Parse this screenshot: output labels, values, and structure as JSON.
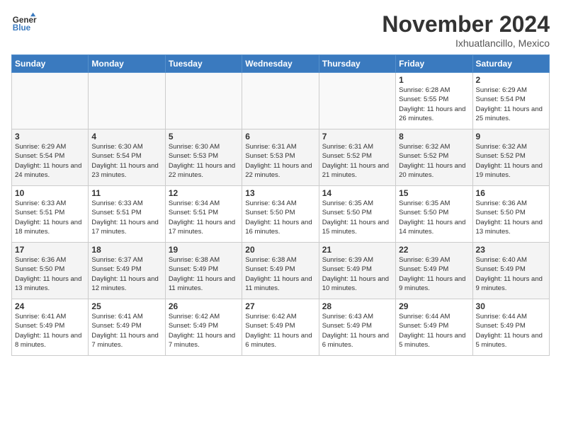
{
  "header": {
    "logo_line1": "General",
    "logo_line2": "Blue",
    "month": "November 2024",
    "location": "Ixhuatlancillo, Mexico"
  },
  "weekdays": [
    "Sunday",
    "Monday",
    "Tuesday",
    "Wednesday",
    "Thursday",
    "Friday",
    "Saturday"
  ],
  "weeks": [
    [
      {
        "day": "",
        "info": ""
      },
      {
        "day": "",
        "info": ""
      },
      {
        "day": "",
        "info": ""
      },
      {
        "day": "",
        "info": ""
      },
      {
        "day": "",
        "info": ""
      },
      {
        "day": "1",
        "info": "Sunrise: 6:28 AM\nSunset: 5:55 PM\nDaylight: 11 hours and 26 minutes."
      },
      {
        "day": "2",
        "info": "Sunrise: 6:29 AM\nSunset: 5:54 PM\nDaylight: 11 hours and 25 minutes."
      }
    ],
    [
      {
        "day": "3",
        "info": "Sunrise: 6:29 AM\nSunset: 5:54 PM\nDaylight: 11 hours and 24 minutes."
      },
      {
        "day": "4",
        "info": "Sunrise: 6:30 AM\nSunset: 5:54 PM\nDaylight: 11 hours and 23 minutes."
      },
      {
        "day": "5",
        "info": "Sunrise: 6:30 AM\nSunset: 5:53 PM\nDaylight: 11 hours and 22 minutes."
      },
      {
        "day": "6",
        "info": "Sunrise: 6:31 AM\nSunset: 5:53 PM\nDaylight: 11 hours and 22 minutes."
      },
      {
        "day": "7",
        "info": "Sunrise: 6:31 AM\nSunset: 5:52 PM\nDaylight: 11 hours and 21 minutes."
      },
      {
        "day": "8",
        "info": "Sunrise: 6:32 AM\nSunset: 5:52 PM\nDaylight: 11 hours and 20 minutes."
      },
      {
        "day": "9",
        "info": "Sunrise: 6:32 AM\nSunset: 5:52 PM\nDaylight: 11 hours and 19 minutes."
      }
    ],
    [
      {
        "day": "10",
        "info": "Sunrise: 6:33 AM\nSunset: 5:51 PM\nDaylight: 11 hours and 18 minutes."
      },
      {
        "day": "11",
        "info": "Sunrise: 6:33 AM\nSunset: 5:51 PM\nDaylight: 11 hours and 17 minutes."
      },
      {
        "day": "12",
        "info": "Sunrise: 6:34 AM\nSunset: 5:51 PM\nDaylight: 11 hours and 17 minutes."
      },
      {
        "day": "13",
        "info": "Sunrise: 6:34 AM\nSunset: 5:50 PM\nDaylight: 11 hours and 16 minutes."
      },
      {
        "day": "14",
        "info": "Sunrise: 6:35 AM\nSunset: 5:50 PM\nDaylight: 11 hours and 15 minutes."
      },
      {
        "day": "15",
        "info": "Sunrise: 6:35 AM\nSunset: 5:50 PM\nDaylight: 11 hours and 14 minutes."
      },
      {
        "day": "16",
        "info": "Sunrise: 6:36 AM\nSunset: 5:50 PM\nDaylight: 11 hours and 13 minutes."
      }
    ],
    [
      {
        "day": "17",
        "info": "Sunrise: 6:36 AM\nSunset: 5:50 PM\nDaylight: 11 hours and 13 minutes."
      },
      {
        "day": "18",
        "info": "Sunrise: 6:37 AM\nSunset: 5:49 PM\nDaylight: 11 hours and 12 minutes."
      },
      {
        "day": "19",
        "info": "Sunrise: 6:38 AM\nSunset: 5:49 PM\nDaylight: 11 hours and 11 minutes."
      },
      {
        "day": "20",
        "info": "Sunrise: 6:38 AM\nSunset: 5:49 PM\nDaylight: 11 hours and 11 minutes."
      },
      {
        "day": "21",
        "info": "Sunrise: 6:39 AM\nSunset: 5:49 PM\nDaylight: 11 hours and 10 minutes."
      },
      {
        "day": "22",
        "info": "Sunrise: 6:39 AM\nSunset: 5:49 PM\nDaylight: 11 hours and 9 minutes."
      },
      {
        "day": "23",
        "info": "Sunrise: 6:40 AM\nSunset: 5:49 PM\nDaylight: 11 hours and 9 minutes."
      }
    ],
    [
      {
        "day": "24",
        "info": "Sunrise: 6:41 AM\nSunset: 5:49 PM\nDaylight: 11 hours and 8 minutes."
      },
      {
        "day": "25",
        "info": "Sunrise: 6:41 AM\nSunset: 5:49 PM\nDaylight: 11 hours and 7 minutes."
      },
      {
        "day": "26",
        "info": "Sunrise: 6:42 AM\nSunset: 5:49 PM\nDaylight: 11 hours and 7 minutes."
      },
      {
        "day": "27",
        "info": "Sunrise: 6:42 AM\nSunset: 5:49 PM\nDaylight: 11 hours and 6 minutes."
      },
      {
        "day": "28",
        "info": "Sunrise: 6:43 AM\nSunset: 5:49 PM\nDaylight: 11 hours and 6 minutes."
      },
      {
        "day": "29",
        "info": "Sunrise: 6:44 AM\nSunset: 5:49 PM\nDaylight: 11 hours and 5 minutes."
      },
      {
        "day": "30",
        "info": "Sunrise: 6:44 AM\nSunset: 5:49 PM\nDaylight: 11 hours and 5 minutes."
      }
    ]
  ]
}
